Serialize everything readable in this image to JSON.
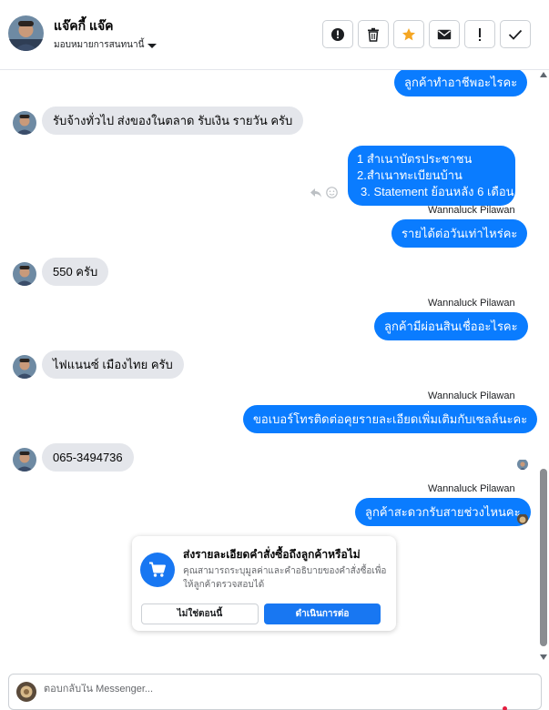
{
  "header": {
    "contact_name": "แจ๊คกี้ แจ๊ค",
    "assign_label": "มอบหมายการสนทนานี้",
    "toolbar": [
      {
        "icon": "alert-circle-icon",
        "action": "spam"
      },
      {
        "icon": "trash-icon",
        "action": "delete"
      },
      {
        "icon": "star-icon",
        "action": "star",
        "color": "#f5a623"
      },
      {
        "icon": "envelope-icon",
        "action": "mark-unread"
      },
      {
        "icon": "exclamation-icon",
        "action": "follow-up"
      },
      {
        "icon": "check-icon",
        "action": "done"
      }
    ]
  },
  "messages": [
    {
      "from": "page",
      "text": "ลูกค้าทำอาชีพอะไรคะ"
    },
    {
      "from": "customer",
      "text": "รับจ้างทั่วไป ส่งของในตลาด รับเงิน รายวัน ครับ"
    },
    {
      "from": "page",
      "lines": [
        "1 สำเนาบัตรประชาชน",
        "2.สำเนาทะเบียนบ้าน",
        "3. Statement ย้อนหลัง 6 เดือน"
      ]
    },
    {
      "from": "page",
      "sender": "Wannaluck Pilawan",
      "text": "รายได้ต่อวันเท่าไหร่คะ"
    },
    {
      "from": "customer",
      "text": "550 ครับ"
    },
    {
      "from": "page",
      "sender": "Wannaluck Pilawan",
      "text": "ลูกค้ามีผ่อนสินเชื่ออะไรคะ"
    },
    {
      "from": "customer",
      "text": "ไฟแนนซ์ เมืองไทย ครับ"
    },
    {
      "from": "page",
      "sender": "Wannaluck Pilawan",
      "text": "ขอเบอร์โทรติดต่อคุยรายละเอียดเพิ่มเติมกับเซลล์นะคะ"
    },
    {
      "from": "customer",
      "text": "065-3494736"
    },
    {
      "from": "page",
      "sender": "Wannaluck Pilawan",
      "text": "ลูกค้าสะดวกรับสายช่วงไหนคะ"
    }
  ],
  "order_prompt": {
    "title": "ส่งรายละเอียดคำสั่งซื้อถึงลูกค้าหรือไม่",
    "description": "คุณสามารถระบุมูลค่าและคำอธิบายของคำสั่งซื้อเพื่อให้ลูกค้าตรวจสอบได้",
    "secondary_button": "ไม่ใช่ตอนนี้",
    "primary_button": "ดำเนินการต่อ"
  },
  "composer": {
    "placeholder": "ตอบกลับใน Messenger..."
  },
  "colors": {
    "outgoing_bubble": "#0a7cff",
    "incoming_bubble": "#e4e6eb",
    "primary": "#1877f2",
    "star": "#f5a623"
  }
}
